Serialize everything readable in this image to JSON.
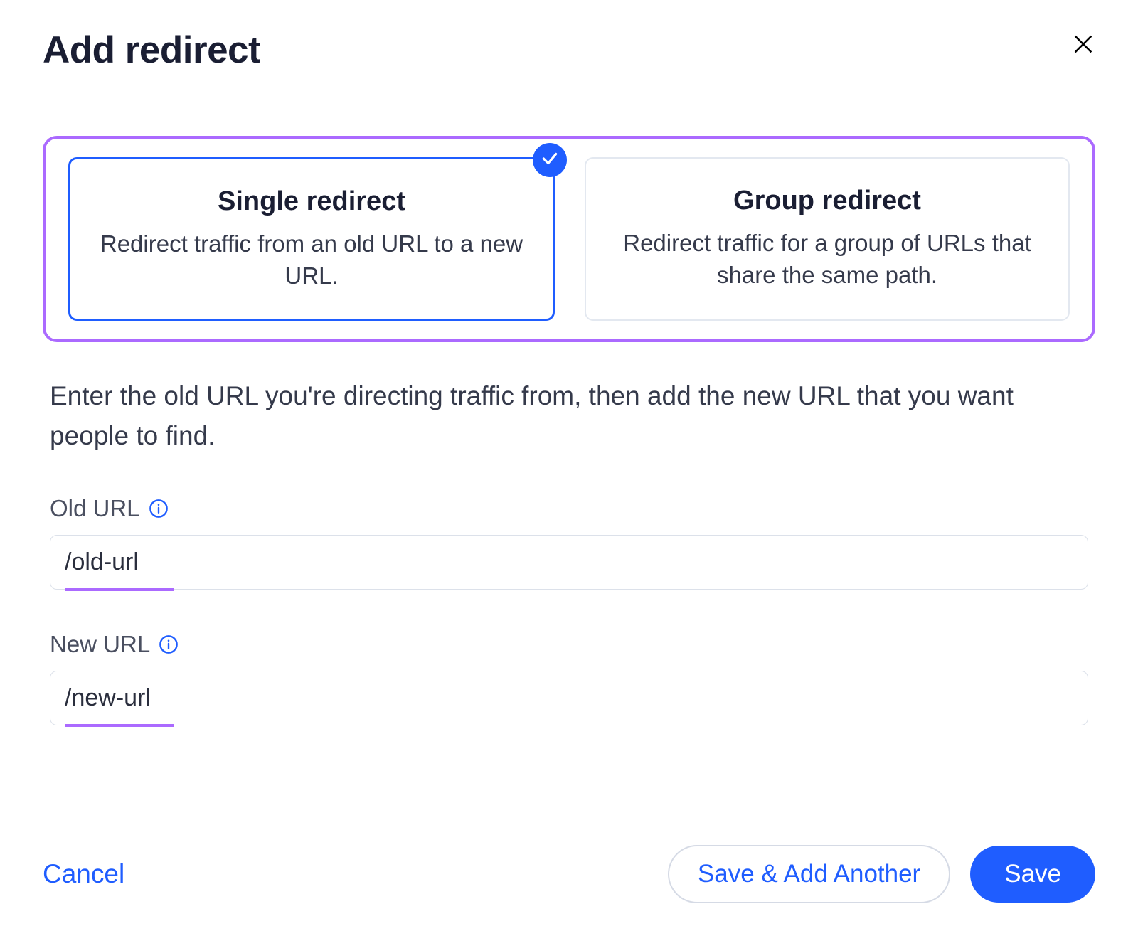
{
  "header": {
    "title": "Add redirect"
  },
  "type_options": {
    "single": {
      "title": "Single redirect",
      "description": "Redirect traffic from an old URL to a new URL.",
      "selected": true
    },
    "group": {
      "title": "Group redirect",
      "description": "Redirect traffic for a group of URLs that share the same path.",
      "selected": false
    }
  },
  "instruction_text": "Enter the old URL you're directing traffic from, then add the new URL that you want people to find.",
  "fields": {
    "old_url": {
      "label": "Old URL",
      "value": "/old-url"
    },
    "new_url": {
      "label": "New URL",
      "value": "/new-url"
    }
  },
  "buttons": {
    "cancel": "Cancel",
    "save_another": "Save & Add Another",
    "save": "Save"
  }
}
